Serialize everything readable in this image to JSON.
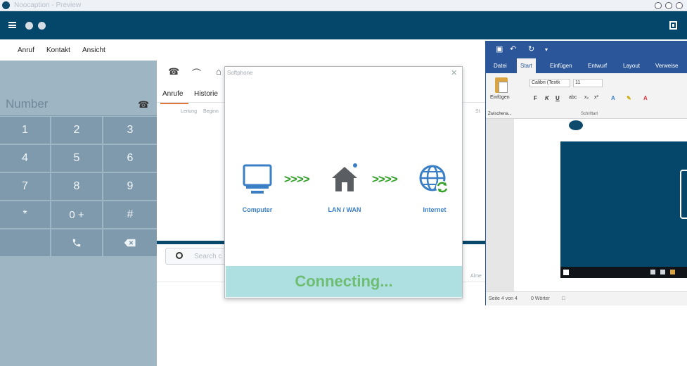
{
  "titlebar": {
    "title": "Noocaption - Preview"
  },
  "menu": {
    "items": [
      "Anruf",
      "Kontakt",
      "Ansicht"
    ]
  },
  "dialer": {
    "placeholder": "Number",
    "keys": [
      "1",
      "2",
      "3",
      "4",
      "5",
      "6",
      "7",
      "8",
      "9",
      "*",
      "0 +",
      "#"
    ]
  },
  "center": {
    "tabs": [
      "Anrufe",
      "Historie"
    ],
    "columns": [
      "Leitung",
      "Beginn",
      "St"
    ],
    "search_placeholder": "Search c",
    "right_label": "Alme"
  },
  "dialog": {
    "title": "Softphone",
    "items": [
      "Computer",
      "LAN / WAN",
      "Internet"
    ],
    "arrows": ">>>>",
    "status": "Connecting..."
  },
  "word": {
    "tabs": [
      "Datei",
      "Start",
      "Einfügen",
      "Entwurf",
      "Layout",
      "Verweise"
    ],
    "paste_label": "Einfügen",
    "clipboard_label": "Zwischenа...",
    "font_name": "Calibri (Textk",
    "font_size": "11",
    "font_group_label": "Schriftart",
    "status_page": "Seite 4 von 4",
    "status_words": "0 Wörter"
  },
  "colors": {
    "topbar": "#04476b",
    "dialer_bg": "#9eb6c4",
    "key_bg": "#7f9aad",
    "word_blue": "#2b579a",
    "connecting_bg": "#aee0e2",
    "connecting_text": "#6fbd72",
    "arrow_green": "#34a02a",
    "label_blue": "#3a7fc6"
  }
}
